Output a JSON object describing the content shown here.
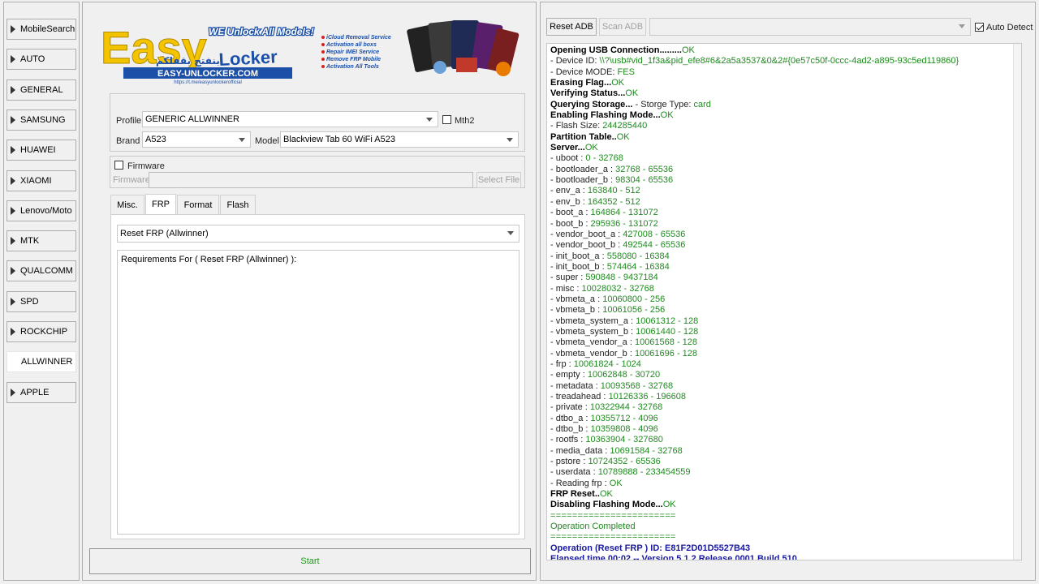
{
  "sidebar": {
    "items": [
      {
        "label": "MobileSearch",
        "active": false
      },
      {
        "label": "AUTO",
        "active": false
      },
      {
        "label": "GENERAL",
        "active": false
      },
      {
        "label": "SAMSUNG",
        "active": false
      },
      {
        "label": "HUAWEI",
        "active": false
      },
      {
        "label": "XIAOMI",
        "active": false
      },
      {
        "label": "Lenovo/Moto",
        "active": false
      },
      {
        "label": "MTK",
        "active": false
      },
      {
        "label": "QUALCOMM",
        "active": false
      },
      {
        "label": "SPD",
        "active": false
      },
      {
        "label": "ROCKCHIP",
        "active": false
      },
      {
        "label": "ALLWINNER",
        "active": true
      },
      {
        "label": "APPLE",
        "active": false
      }
    ]
  },
  "banner": {
    "tagline": "WE Unlock All Models!",
    "logo_word1": "Easy",
    "logo_word2": "Locker",
    "arabic": "بنفتح بقفلكم",
    "site": "EASY-UNLOCKER.COM",
    "site_sub": "https://t.me/easyunlockerofficial",
    "features": [
      "iCloud Removal Service",
      "Activation all boxs",
      "Repair IMEI Service",
      "Remove FRP Mobile",
      "Activation All Tools"
    ],
    "colors": {
      "yellow": "#f4c400",
      "blue": "#1b4fa8",
      "red": "#d62020"
    }
  },
  "profile": {
    "profile_label": "Profile",
    "profile_value": "GENERIC ALLWINNER",
    "mth2_label": "Mth2",
    "brand_label": "Brand",
    "brand_value": "A523",
    "model_label": "Model",
    "model_value": "Blackview Tab 60 WiFi A523"
  },
  "firmware": {
    "checkbox_label": "Firmware",
    "field_label": "Firmware",
    "select_file": "Select File"
  },
  "tabs": [
    {
      "label": "Misc.",
      "active": false
    },
    {
      "label": "FRP",
      "active": true
    },
    {
      "label": "Format",
      "active": false
    },
    {
      "label": "Flash",
      "active": false
    }
  ],
  "frp": {
    "operation": "Reset FRP  (Allwinner)",
    "requirements": "Requirements For ( Reset FRP  (Allwinner) ):"
  },
  "start_label": "Start",
  "adb": {
    "reset_adb": "Reset ADB",
    "scan_adb": "Scan ADB",
    "device_value": "",
    "auto_detect": "Auto Detect"
  },
  "log": [
    [
      {
        "t": "Opening USB Connection.........",
        "c": "b"
      },
      {
        "t": "OK",
        "c": "g"
      }
    ],
    [
      {
        "t": "- Device ID: ",
        "c": ""
      },
      {
        "t": "\\\\?\\usb#vid_1f3a&pid_efe8#6&2a5a3537&0&2#{0e57c50f-0ccc-4ad2-a895-93c5ed119860}",
        "c": "g"
      }
    ],
    [
      {
        "t": "- Device MODE: ",
        "c": ""
      },
      {
        "t": "FES",
        "c": "g"
      }
    ],
    [
      {
        "t": "Erasing Flag...",
        "c": "b"
      },
      {
        "t": "OK",
        "c": "g"
      }
    ],
    [
      {
        "t": "Verifying Status...",
        "c": "b"
      },
      {
        "t": "OK",
        "c": "g"
      }
    ],
    [
      {
        "t": "Querying Storage...",
        "c": "b"
      },
      {
        "t": " - Storge Type: ",
        "c": ""
      },
      {
        "t": "card",
        "c": "g"
      }
    ],
    [
      {
        "t": "Enabling Flashing Mode...",
        "c": "b"
      },
      {
        "t": "OK",
        "c": "g"
      }
    ],
    [
      {
        "t": "- Flash Size: ",
        "c": ""
      },
      {
        "t": "244285440",
        "c": "g"
      }
    ],
    [
      {
        "t": "Partition Table..",
        "c": "b"
      },
      {
        "t": "OK",
        "c": "g"
      }
    ],
    [
      {
        "t": "Server...",
        "c": "b"
      },
      {
        "t": "OK",
        "c": "g"
      }
    ],
    [
      {
        "t": "- uboot : ",
        "c": ""
      },
      {
        "t": "0 - 32768",
        "c": "g"
      }
    ],
    [
      {
        "t": "- bootloader_a : ",
        "c": ""
      },
      {
        "t": "32768 - 65536",
        "c": "g"
      }
    ],
    [
      {
        "t": "- bootloader_b : ",
        "c": ""
      },
      {
        "t": "98304 - 65536",
        "c": "g"
      }
    ],
    [
      {
        "t": "- env_a : ",
        "c": ""
      },
      {
        "t": "163840 - 512",
        "c": "g"
      }
    ],
    [
      {
        "t": "- env_b : ",
        "c": ""
      },
      {
        "t": "164352 - 512",
        "c": "g"
      }
    ],
    [
      {
        "t": "- boot_a : ",
        "c": ""
      },
      {
        "t": "164864 - 131072",
        "c": "g"
      }
    ],
    [
      {
        "t": "- boot_b : ",
        "c": ""
      },
      {
        "t": "295936 - 131072",
        "c": "g"
      }
    ],
    [
      {
        "t": "- vendor_boot_a : ",
        "c": ""
      },
      {
        "t": "427008 - 65536",
        "c": "g"
      }
    ],
    [
      {
        "t": "- vendor_boot_b : ",
        "c": ""
      },
      {
        "t": "492544 - 65536",
        "c": "g"
      }
    ],
    [
      {
        "t": "- init_boot_a : ",
        "c": ""
      },
      {
        "t": "558080 - 16384",
        "c": "g"
      }
    ],
    [
      {
        "t": "- init_boot_b : ",
        "c": ""
      },
      {
        "t": "574464 - 16384",
        "c": "g"
      }
    ],
    [
      {
        "t": "- super : ",
        "c": ""
      },
      {
        "t": "590848 - 9437184",
        "c": "g"
      }
    ],
    [
      {
        "t": "- misc : ",
        "c": ""
      },
      {
        "t": "10028032 - 32768",
        "c": "g"
      }
    ],
    [
      {
        "t": "- vbmeta_a : ",
        "c": ""
      },
      {
        "t": "10060800 - 256",
        "c": "g"
      }
    ],
    [
      {
        "t": "- vbmeta_b : ",
        "c": ""
      },
      {
        "t": "10061056 - 256",
        "c": "g"
      }
    ],
    [
      {
        "t": "- vbmeta_system_a : ",
        "c": ""
      },
      {
        "t": "10061312 - 128",
        "c": "g"
      }
    ],
    [
      {
        "t": "- vbmeta_system_b : ",
        "c": ""
      },
      {
        "t": "10061440 - 128",
        "c": "g"
      }
    ],
    [
      {
        "t": "- vbmeta_vendor_a : ",
        "c": ""
      },
      {
        "t": "10061568 - 128",
        "c": "g"
      }
    ],
    [
      {
        "t": "- vbmeta_vendor_b : ",
        "c": ""
      },
      {
        "t": "10061696 - 128",
        "c": "g"
      }
    ],
    [
      {
        "t": "- frp : ",
        "c": ""
      },
      {
        "t": "10061824 - 1024",
        "c": "g"
      }
    ],
    [
      {
        "t": "- empty : ",
        "c": ""
      },
      {
        "t": "10062848 - 30720",
        "c": "g"
      }
    ],
    [
      {
        "t": "- metadata : ",
        "c": ""
      },
      {
        "t": "10093568 - 32768",
        "c": "g"
      }
    ],
    [
      {
        "t": "- treadahead : ",
        "c": ""
      },
      {
        "t": "10126336 - 196608",
        "c": "g"
      }
    ],
    [
      {
        "t": "- private : ",
        "c": ""
      },
      {
        "t": "10322944 - 32768",
        "c": "g"
      }
    ],
    [
      {
        "t": "- dtbo_a : ",
        "c": ""
      },
      {
        "t": "10355712 - 4096",
        "c": "g"
      }
    ],
    [
      {
        "t": "- dtbo_b : ",
        "c": ""
      },
      {
        "t": "10359808 - 4096",
        "c": "g"
      }
    ],
    [
      {
        "t": "- rootfs : ",
        "c": ""
      },
      {
        "t": "10363904 - 327680",
        "c": "g"
      }
    ],
    [
      {
        "t": "- media_data : ",
        "c": ""
      },
      {
        "t": "10691584 - 32768",
        "c": "g"
      }
    ],
    [
      {
        "t": "- pstore : ",
        "c": ""
      },
      {
        "t": "10724352 - 65536",
        "c": "g"
      }
    ],
    [
      {
        "t": "- userdata : ",
        "c": ""
      },
      {
        "t": "10789888 - 233454559",
        "c": "g"
      }
    ],
    [
      {
        "t": "- Reading frp : ",
        "c": ""
      },
      {
        "t": "OK",
        "c": "g"
      }
    ],
    [
      {
        "t": "FRP Reset..",
        "c": "b"
      },
      {
        "t": "OK",
        "c": "g"
      }
    ],
    [
      {
        "t": "Disabling Flashing Mode...",
        "c": "b"
      },
      {
        "t": "OK",
        "c": "g"
      }
    ],
    [
      {
        "t": "=======================",
        "c": "sep"
      }
    ],
    [
      {
        "t": "Operation Completed",
        "c": "g"
      }
    ],
    [
      {
        "t": "=======================",
        "c": "sep"
      }
    ],
    [
      {
        "t": "Operation  (Reset FRP ) ID: E81F2D01D5527B43",
        "c": "n"
      }
    ],
    [
      {
        "t": "Elapsed time 00:02 -- Version 5.1.2 Release 0001 Build 510",
        "c": "n"
      }
    ]
  ]
}
